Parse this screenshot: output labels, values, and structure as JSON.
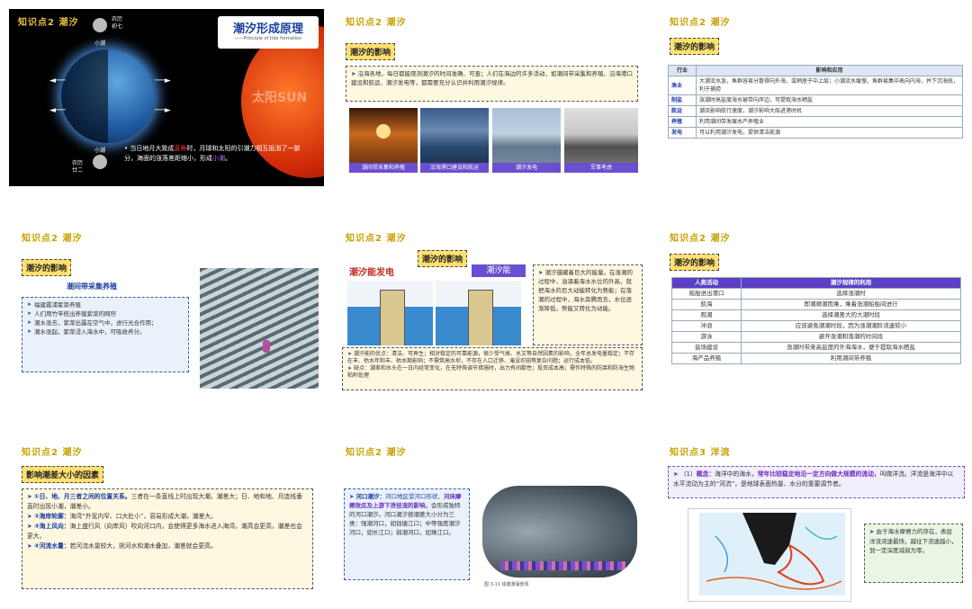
{
  "s1": {
    "kp": "知识点2 潮汐",
    "title": "潮汐形成原理",
    "subtitle": "——Principle of tide formation",
    "moon_top_label": "农历\n初七",
    "small_moon_top": "小潮",
    "small_moon_bottom": "小潮",
    "moon_bottom_label": "农历\n廿二",
    "sun_label": "太阳SUN",
    "text_a": "当日地月大致成",
    "text_red": "直角",
    "text_b": "时，月球和太阳的引潮力相互抵消了一部分，海面的涨落差距缩小，形成",
    "text_purple": "小潮",
    "text_end": "。"
  },
  "s2": {
    "kp": "知识点2 潮汐",
    "tag": "潮汐的影响",
    "note": "沿海各地，每日都能观测潮汐的时间准确、可查；人们在海边的许多活动，如潮间带采集和养殖、沿海港口建设和航运、潮汐发电等，都需要充分认识并利用潮汐规律。",
    "photos": [
      "潮间带采集和养殖",
      "沿海港口建设和航运",
      "潮汐发电",
      "军事考虑"
    ]
  },
  "s3": {
    "kp": "知识点2 潮汐",
    "tag": "潮汐的影响",
    "head": [
      "行业",
      "影响和应用"
    ],
    "rows": [
      [
        "渔业",
        "大潮流水急，鱼群容易分散得向外海，或稍居于中上层；小潮流水缓慢，鱼群易集中表向内海，并下沉海底，利于捕捞"
      ],
      [
        "制盐",
        "涨潮时高盐度海水被带向岸边，可提取海水晒盐"
      ],
      [
        "航运",
        "潮流影响航行速度，潮汐影响大船进港时机"
      ],
      [
        "养殖",
        "利用潮间带发展水产养殖业"
      ],
      [
        "发电",
        "可以利用潮汐发电，提供清洁能源"
      ]
    ]
  },
  "s4": {
    "kp": "知识点2 潮汐",
    "tag": "潮汐的影响",
    "heading": "潮间带采集养殖",
    "items": [
      "福建霞浦紫菜养殖",
      "人们用竹竿搭出养殖紫菜的网帘",
      "潮水涨去，紫菜出露在空气中，进行光合作用；",
      "潮水涨起，紫菜浸入海水中，可吸收养分。"
    ]
  },
  "s5": {
    "kp": "知识点2 潮汐",
    "tag": "潮汐的影响",
    "title_left": "潮汐能发电",
    "title_right": "潮汐能",
    "note_right": "潮汐蕴藏着巨大的能量。在涨潮的过程中，汹涌着海水水位的升高，就把海水的巨大动能转化为势能；在落潮的过程中，海水奔腾而去，水位逐渐降低，势能又转化为动能。",
    "note_bottom_1": "潮汐能的优点：清洁、可再生；相对稳定的可靠能源，很少受气候、水文等自然因素的影响，全年总发电量稳定；不存在丰、枯水年和丰、枯水期影响；不需筑高水坝，不存在人口迁移、淹没农田等复杂问题；运行成本低。",
    "note_bottom_2": "缺点：潮差和水头在一日内经常变化，在无特殊调节措施时，出力有间歇性；投资成本高；需作特殊的防腐和防海生物粘附处理"
  },
  "s6": {
    "kp": "知识点2 潮汐",
    "tag": "潮汐的影响",
    "head": [
      "人类活动",
      "潮汐规律的利用"
    ],
    "rows": [
      [
        "船舶进出港口",
        "选择涨潮时"
      ],
      [
        "航海",
        "即潮顺潮而乘，乘着涨潮船舶间进行"
      ],
      [
        "观潮",
        "选择潮差大的大潮时段"
      ],
      [
        "冲浪",
        "应该避免潮潮时段，因为涨潮潮阶流速较小"
      ],
      [
        "游泳",
        "避开涨潮和落潮的时间段"
      ],
      [
        "盐场建设",
        "涨潮时带来高盐度的外海海水，便于提取海水晒盐"
      ],
      [
        "海产品养殖",
        "利用潮间带养殖"
      ]
    ]
  },
  "s7": {
    "kp": "知识点2 潮汐",
    "tag": "影响潮差大小的因素",
    "items": [
      {
        "h": "①日、地、月三者之间的位置关系。",
        "t": "三者在一条直线上时出现大潮，潮差大；日、地和地、月连线垂直时出现小潮，潮差小。"
      },
      {
        "h": "②海岸轮廓：",
        "t": "海湾“外宽内窄、口大肚小”，容易形成大潮，潮差大。"
      },
      {
        "h": "③海上风向：",
        "t": "海上盛行风（向岸风）吹向河口内，会使得更多海水进入海湾，潮高会更高，潮差也会更大。"
      },
      {
        "h": "④河流水量：",
        "t": "若河流水量较大，则河水和潮水叠加，潮差就会更高。"
      }
    ]
  },
  "s8": {
    "kp": "知识点2 潮汐",
    "h": "河口潮汐：",
    "t": "河口地区受河口形状、",
    "t2": "河床摩擦效应及上游下泄径流的影响，",
    "t3": "会形成独特的河口潮汐。河口潮汐按潮差大小分为三类：强潮河口，如钱塘江口；中等强度潮汐河口，如长江口；弱潮河口，如珠江口。",
    "caption": "图 3-11 钱塘潮涌景观"
  },
  "s9": {
    "kp": "知识点3 洋流",
    "num": "（1）",
    "concept": "概念：",
    "t1": "海洋中的海水，",
    "t2": "常年比较稳定地沿一定方向做大规模的流动，",
    "t3": "叫做洋流。洋流是海洋中以水平流动为主的“河流”，是地球表面热量、水分的重要调节者。",
    "side": "由于海水摩擦力的存在，表层洋流流速最快，越往下流速越小，到一定深度减弱为零。"
  }
}
